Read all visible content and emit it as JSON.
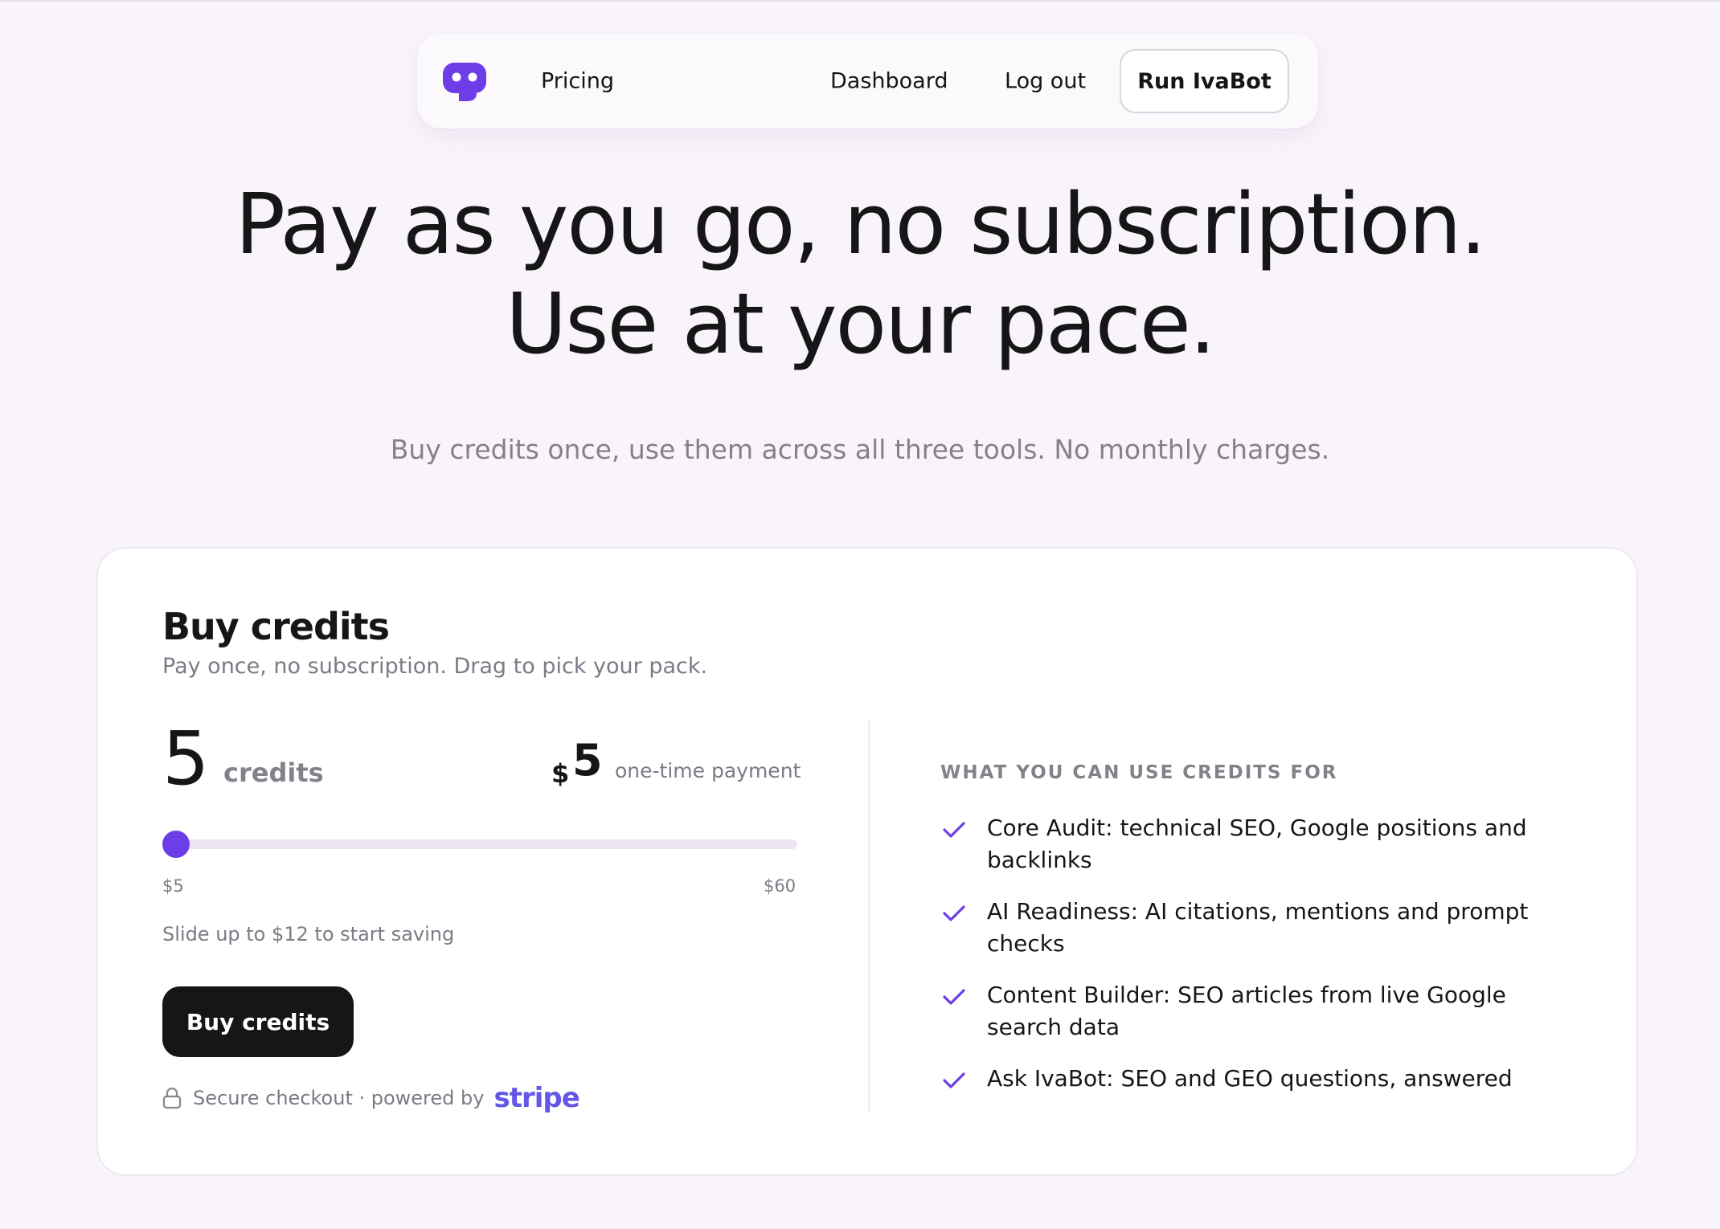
{
  "nav": {
    "logo_icon": "robot-face-icon",
    "pricing": "Pricing",
    "dashboard": "Dashboard",
    "logout": "Log out",
    "run": "Run IvaBot"
  },
  "hero": {
    "title_line1": "Pay as you go, no subscription.",
    "title_line2": "Use at your pace.",
    "subtitle": "Buy credits once, use them across all three tools. No monthly charges."
  },
  "card": {
    "title": "Buy credits",
    "subtitle": "Pay once, no subscription. Drag to pick your pack.",
    "credits_value": "5",
    "credits_label": "credits",
    "price_currency": "$",
    "price_value": "5",
    "price_note": "one-time payment",
    "slider": {
      "min_label": "$5",
      "max_label": "$60",
      "min": 5,
      "max": 60,
      "value": 5
    },
    "hint": "Slide up to $12 to start saving",
    "buy_label": "Buy credits",
    "secure_text": "Secure checkout · powered by",
    "stripe": "stripe",
    "uses_heading": "WHAT YOU CAN USE CREDITS FOR",
    "uses": [
      "Core Audit: technical SEO, Google positions and backlinks",
      "AI Readiness: AI citations, mentions and prompt checks",
      "Content Builder: SEO articles from live Google search data",
      "Ask IvaBot: SEO and GEO questions, answered"
    ]
  },
  "colors": {
    "accent": "#6d3ee8",
    "stripe": "#6457e8",
    "background": "#f9f4fc"
  }
}
